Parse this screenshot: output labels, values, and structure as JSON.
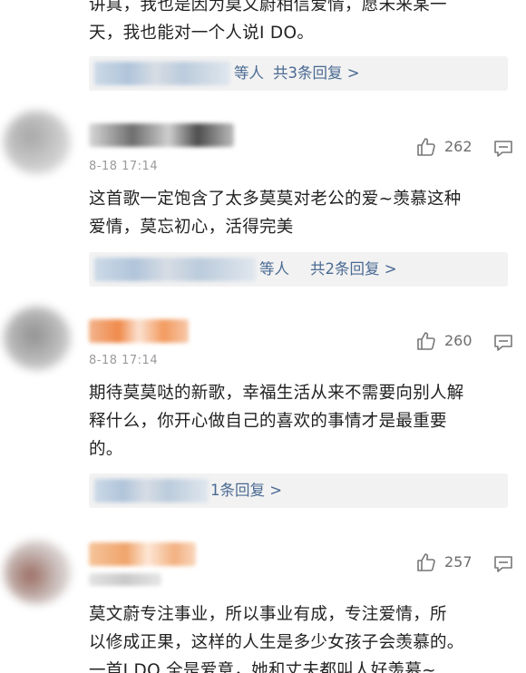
{
  "comments": [
    {
      "lines": [
        "讲真，我也是因为莫文蔚相信爱情，愿未来某一",
        "天，我也能对一个人说I DO。"
      ],
      "reply_suffix": "等人",
      "reply_count": "共3条回复 >"
    },
    {
      "time": "8-18 17:14",
      "likes": "262",
      "lines": [
        "这首歌一定饱含了太多莫莫对老公的爱~羡慕这种",
        "爱情，莫忘初心，活得完美"
      ],
      "reply_suffix": "等人",
      "reply_count": "共2条回复 >"
    },
    {
      "time": "8-18 17:14",
      "likes": "260",
      "lines": [
        "期待莫莫哒的新歌，幸福生活从来不需要向别人解",
        "释什么，你开心做自己的喜欢的事情才是最重要",
        "的。"
      ],
      "reply_count": "1条回复 >"
    },
    {
      "likes": "257",
      "lines": [
        "莫文蔚专注事业，所以事业有成，专注爱情，所",
        "以修成正果，这样的人生是多少女孩子会羡慕的。",
        "一首I DO 全是爱意，她和丈夫都叫人好羡慕~"
      ]
    }
  ],
  "icons": {
    "like": "thumbs-up-icon",
    "comment": "comment-bubble-icon"
  },
  "colors": {
    "reply_link": "#4a6a93",
    "reply_bg": "#f2f2f2",
    "meta": "#9a9a9a"
  }
}
